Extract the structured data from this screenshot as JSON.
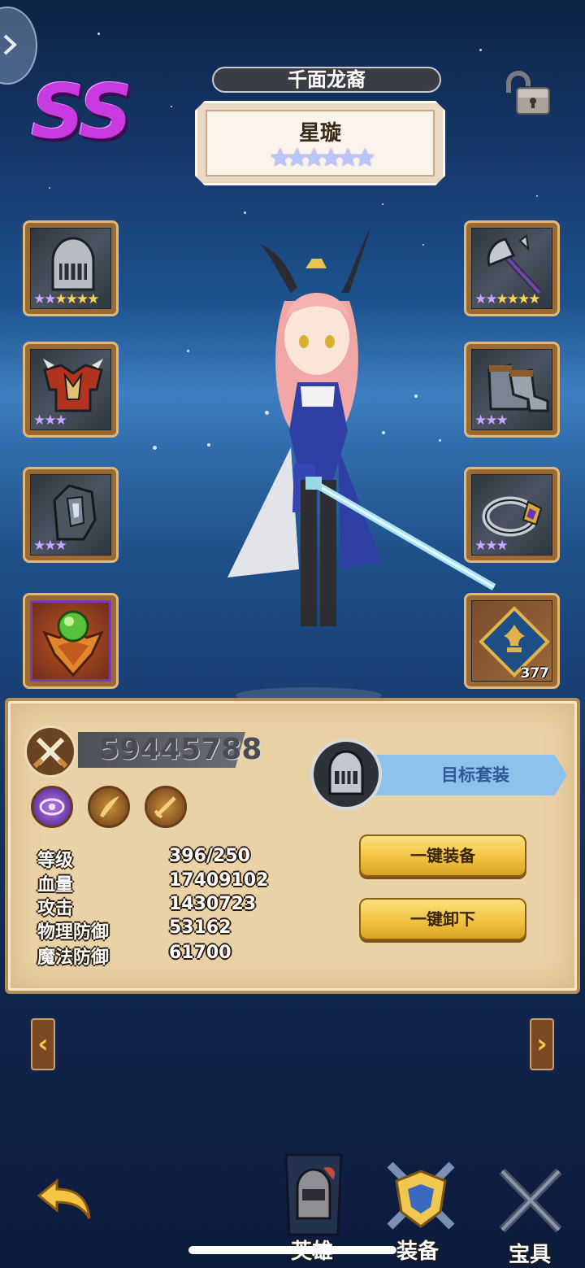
{
  "header": {
    "rank_badge": "SS",
    "title": "千面龙裔",
    "hero_name": "星璇",
    "hero_stars": "★★★★★★"
  },
  "equipment_slots": {
    "helmet_stars": {
      "purple": "★★",
      "gold": "★★★★"
    },
    "armor_stars": {
      "purple": "★★★",
      "gold": ""
    },
    "gauntlet_stars": {
      "purple": "★★★",
      "gold": ""
    },
    "axe_stars": {
      "purple": "★★",
      "gold": "★★★★"
    },
    "boots_stars": {
      "purple": "★★★",
      "gold": ""
    },
    "ring_stars": {
      "purple": "★★★",
      "gold": ""
    },
    "emblem_count": "377"
  },
  "panel": {
    "power": "59445788",
    "target_set_label": "目标套装",
    "stats": [
      {
        "label": "等级",
        "value": "396/250"
      },
      {
        "label": "血量",
        "value": "17409102"
      },
      {
        "label": "攻击",
        "value": "1430723"
      },
      {
        "label": "物理防御",
        "value": "53162"
      },
      {
        "label": "魔法防御",
        "value": "61700"
      }
    ],
    "equip_all_label": "一键装备",
    "unequip_all_label": "一键卸下"
  },
  "nav": {
    "prev": "‹",
    "next": "›"
  },
  "tabs": [
    {
      "label": "英雄"
    },
    {
      "label": "装备"
    },
    {
      "label": "宝具"
    }
  ],
  "colors": {
    "accent_gold": "#f2c340",
    "rank_purple": "#c93be0",
    "target_blue": "#8ec2ec"
  },
  "icons": [
    "back-arrow-icon",
    "lock-open-icon",
    "helmet-icon",
    "armor-icon",
    "gauntlet-icon",
    "axe-icon",
    "boots-icon",
    "ring-icon",
    "gem-crest-icon",
    "emblem-icon",
    "crossed-swords-icon",
    "eye-skill-icon",
    "saber-skill-icon",
    "sword-skill-icon",
    "return-arrow-icon"
  ]
}
